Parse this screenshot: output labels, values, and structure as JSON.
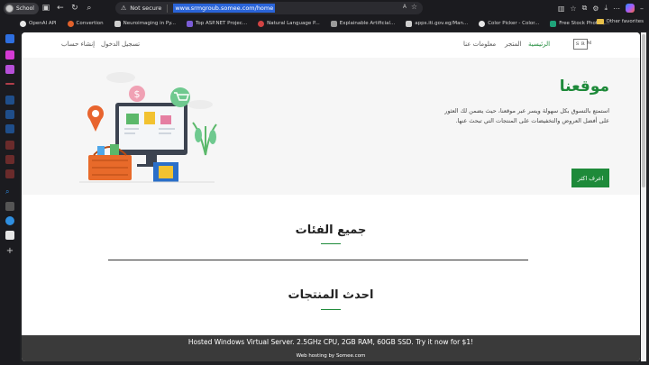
{
  "browser": {
    "profile_name": "School",
    "address": {
      "security_label": "Not secure",
      "url": "www.srmgroub.somee.com/home"
    },
    "bookmarks": [
      {
        "label": "OpenAI API",
        "icon": "openai-icon",
        "color": "#e6e6e6"
      },
      {
        "label": "Convertion",
        "icon": "convert-icon",
        "color": "#e0612b"
      },
      {
        "label": "Neuroimaging in Py...",
        "icon": "page-icon",
        "color": "#cfcfcf"
      },
      {
        "label": "Top ASP.NET Projec...",
        "icon": "aspnet-icon",
        "color": "#7b5cd6"
      },
      {
        "label": "Natural Language P...",
        "icon": "nlp-icon",
        "color": "#d14343"
      },
      {
        "label": "Explainable Artificial...",
        "icon": "ai-icon",
        "color": "#9a9a9a"
      },
      {
        "label": "apps.iti.gov.eg/Man...",
        "icon": "page-icon",
        "color": "#cfcfcf"
      },
      {
        "label": "Color Picker - Color...",
        "icon": "color-picker-icon",
        "color": "#e6e6e6"
      },
      {
        "label": "Free Stock Photos,...",
        "icon": "photos-icon",
        "color": "#1fa37a"
      }
    ],
    "bookmarks_folder": "Other favorites"
  },
  "site": {
    "nav": {
      "logo": "S R",
      "logo_m": "M",
      "home": "الرئيسية",
      "store": "المتجر",
      "about": "معلومات عنا",
      "login": "تسجيل الدخول",
      "register": "إنشاء حساب"
    },
    "hero": {
      "title": "موقعنا",
      "description": "استمتع بالتسوق بكل سهولة ويسر عبر موقعنا، حيث يضمن لك العثور على أفضل العروض والتخفيضات على المنتجات التي تبحث عنها.",
      "button": "اعرف اكثر"
    },
    "sections": {
      "categories": "جميع الفئات",
      "latest": "احدث المنتجات"
    },
    "footer": {
      "promo": "Hosted Windows Virtual Server. 2.5GHz CPU, 2GB RAM, 60GB SSD. Try it now for $1!",
      "hosting": "Web hosting by Somee.com"
    }
  },
  "colors": {
    "brand_green": "#1e8a3a",
    "hero_bg": "#f6f6f6",
    "footer_bg": "#3a3a3a"
  }
}
